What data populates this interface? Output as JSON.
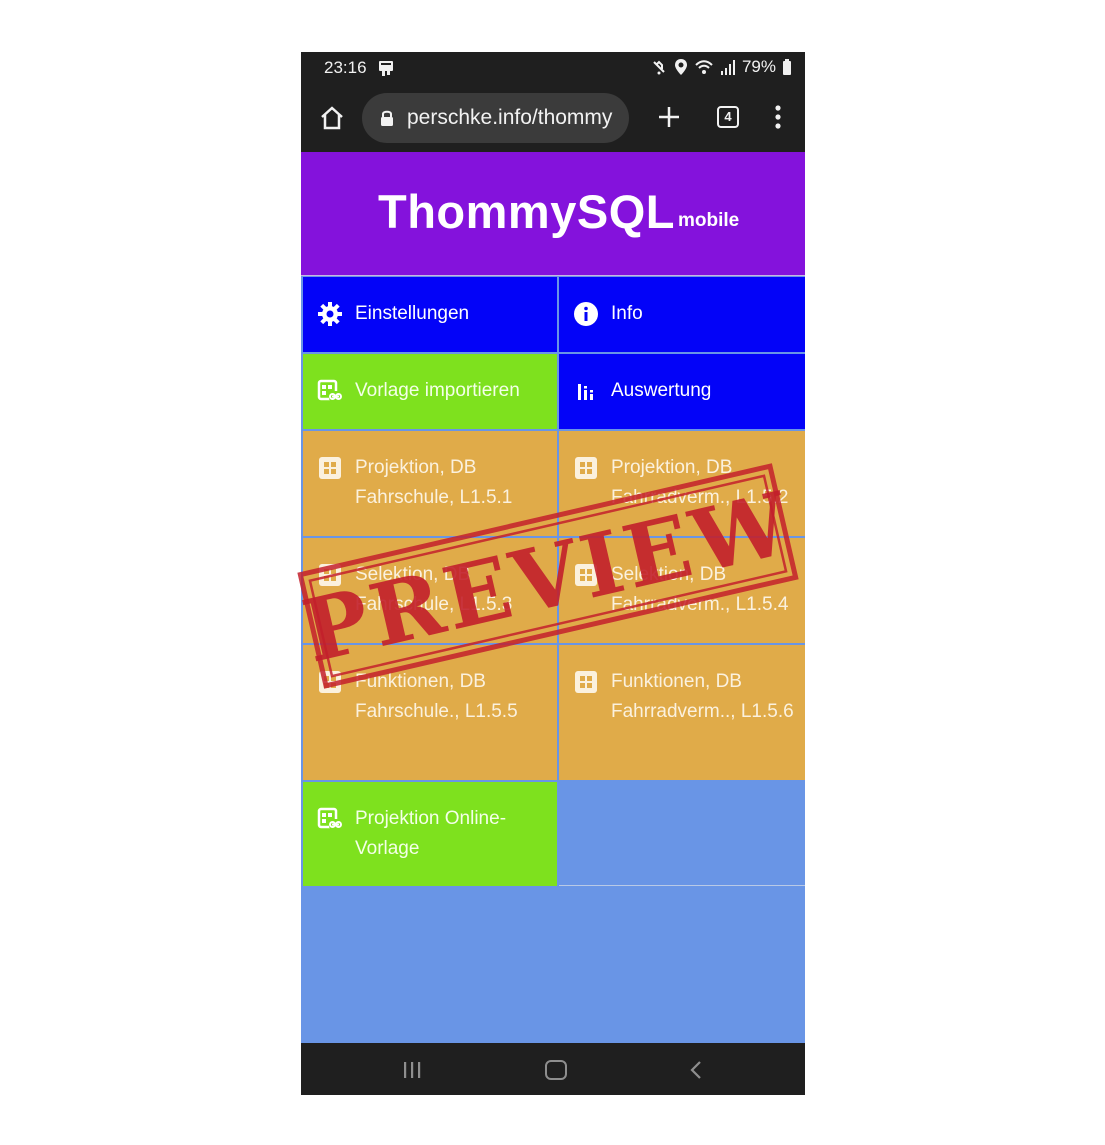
{
  "statusbar": {
    "time": "23:16",
    "battery": "79%"
  },
  "browser": {
    "url": "perschke.info/thommy",
    "tab_count": "4"
  },
  "app": {
    "title": "ThommySQL",
    "subtitle": "mobile"
  },
  "tiles": [
    {
      "label": "Einstellungen",
      "icon": "gear-icon",
      "color": "#0303f8"
    },
    {
      "label": "Info",
      "icon": "info-icon",
      "color": "#0303f8"
    },
    {
      "label": "Vorlage importieren",
      "icon": "import-template-icon",
      "color": "#7ee11e"
    },
    {
      "label": "Auswertung",
      "icon": "bar-chart-icon",
      "color": "#0303f8"
    },
    {
      "label": "Projektion, DB Fahrschule, L1.5.1",
      "icon": "grid-icon",
      "color": "#e0ab49"
    },
    {
      "label": "Projektion, DB Fahrradverm., L1.5.2",
      "icon": "grid-icon",
      "color": "#e0ab49"
    },
    {
      "label": "Selektion, DB Fahrschule, L1.5.3",
      "icon": "grid-icon",
      "color": "#e0ab49"
    },
    {
      "label": "Selektion, DB Fahrradverm., L1.5.4",
      "icon": "grid-icon",
      "color": "#e0ab49"
    },
    {
      "label": "Funktionen, DB Fahrschule., L1.5.5",
      "icon": "grid-icon",
      "color": "#e0ab49"
    },
    {
      "label": "Funktionen, DB Fahrradverm.., L1.5.6",
      "icon": "grid-icon",
      "color": "#e0ab49"
    },
    {
      "label": "Projektion Online-Vorlage",
      "icon": "import-template-icon",
      "color": "#7ee11e"
    }
  ],
  "colors": {
    "header": "#8412dc",
    "background": "#6995e6",
    "system_bar": "#1f1f1f"
  },
  "watermark": {
    "text": "PREVIEW",
    "color": "#c3202c"
  }
}
